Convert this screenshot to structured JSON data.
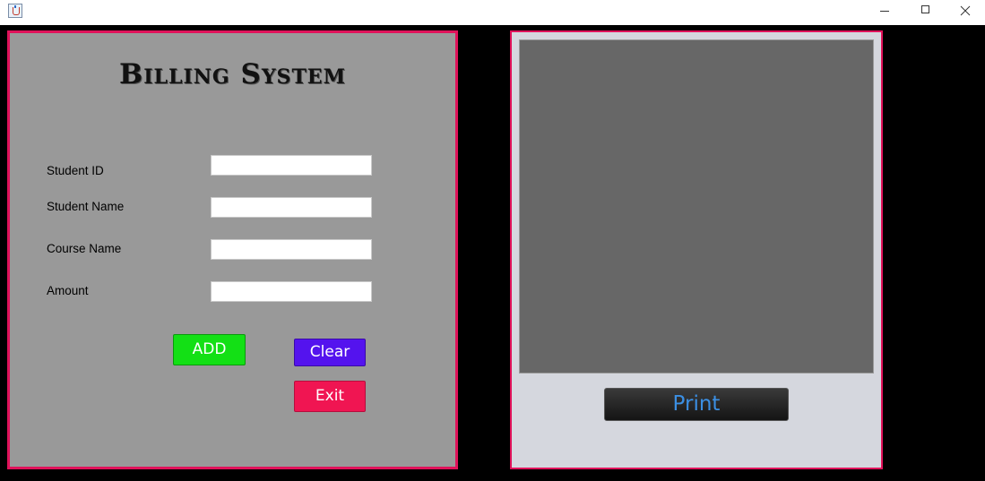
{
  "window": {
    "icon": "java-cup-icon"
  },
  "form": {
    "title": "Billing System",
    "fields": [
      {
        "label": "Student ID",
        "value": ""
      },
      {
        "label": "Student Name",
        "value": ""
      },
      {
        "label": "Course Name",
        "value": ""
      },
      {
        "label": "Amount",
        "value": ""
      }
    ],
    "buttons": {
      "add": "ADD",
      "clear": "Clear",
      "exit": "Exit"
    }
  },
  "preview": {
    "print_label": "Print"
  },
  "colors": {
    "border": "#e0125a",
    "add": "#13e015",
    "clear": "#5413ee",
    "exit": "#f01552",
    "print_text": "#3b8fe3"
  }
}
